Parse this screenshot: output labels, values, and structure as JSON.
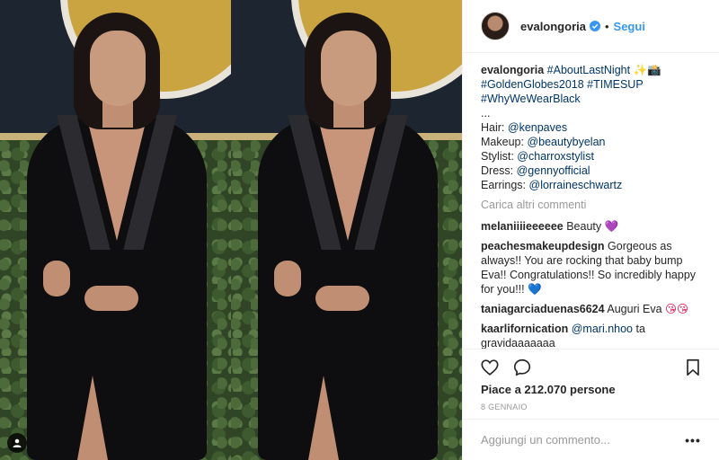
{
  "post": {
    "username": "evalongoria",
    "follow_label": "Segui",
    "separator": "•",
    "caption": {
      "username": "evalongoria",
      "line1": "#AboutLastNight ✨📸",
      "line2": "#GoldenGlobes2018 #TIMESUP",
      "line3": "#WhyWeWearBlack",
      "ellipsis": "...",
      "credits": [
        {
          "label": "Hair:",
          "tag": "@kenpaves"
        },
        {
          "label": "Makeup:",
          "tag": "@beautybyelan"
        },
        {
          "label": "Stylist:",
          "tag": "@charroxstylist"
        },
        {
          "label": "Dress:",
          "tag": "@gennyofficial"
        },
        {
          "label": "Earrings:",
          "tag": "@lorraineschwartz"
        }
      ]
    },
    "load_more": "Carica altri commenti",
    "comments": [
      {
        "user": "melaniiiieeeeee",
        "text": "Beauty",
        "emoji": "💜"
      },
      {
        "user": "peachesmakeupdesign",
        "text": "Gorgeous as always!! You are rocking that baby bump Eva!! Congratulations!! So incredibly happy for you!!!",
        "emoji": "💙"
      },
      {
        "user": "taniagarciaduenas6624",
        "text": "Auguri Eva",
        "emoji": "😘😘"
      },
      {
        "user": "kaarlifornication",
        "mention": "@mari.nhoo",
        "text": "ta gravidaaaaaaa"
      },
      {
        "user": "",
        "text": "",
        "emoji": "😍😍😍😍😍💕"
      }
    ],
    "likes": "Piace a 212.070 persone",
    "date": "8 GENNAIO",
    "comment_placeholder": "Aggiungi un commento...",
    "more_label": "•••"
  },
  "icons": {
    "avatar": "avatar",
    "verified": "verified-badge-icon",
    "like": "heart-icon",
    "comment": "speech-bubble-icon",
    "save": "bookmark-icon",
    "tagged": "user-tag-icon"
  },
  "colors": {
    "link": "#3897f0",
    "hashtag": "#003569",
    "muted": "#999999",
    "text": "#262626"
  }
}
